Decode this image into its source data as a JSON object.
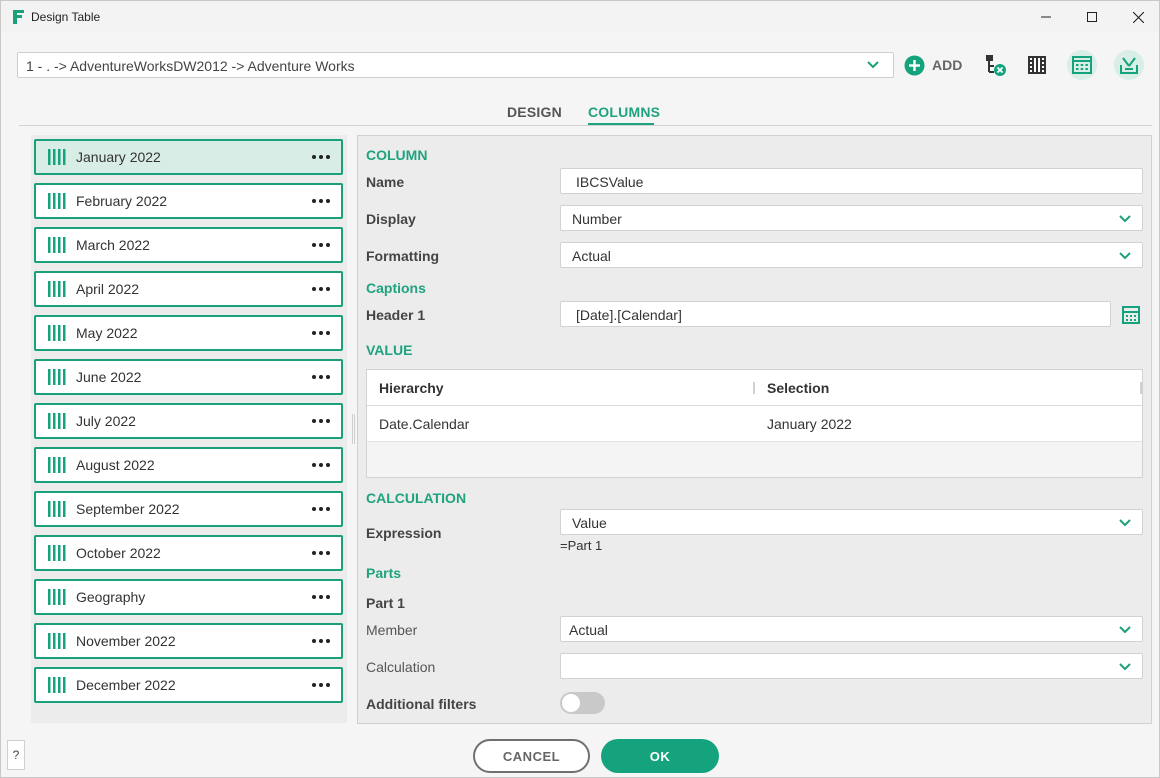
{
  "window": {
    "title": "Design Table"
  },
  "toolbar": {
    "path": "1 - . -> AdventureWorksDW2012 -> Adventure Works",
    "add_label": "ADD",
    "icons": [
      "add-circle-icon",
      "hierarchy-remove-icon",
      "film-columns-icon",
      "calendar-grid-icon",
      "import-icon"
    ]
  },
  "tabs": [
    {
      "label": "DESIGN",
      "active": false
    },
    {
      "label": "COLUMNS",
      "active": true
    }
  ],
  "columns_list": [
    {
      "label": "January 2022",
      "selected": true
    },
    {
      "label": "February 2022"
    },
    {
      "label": "March 2022"
    },
    {
      "label": "April 2022"
    },
    {
      "label": "May 2022"
    },
    {
      "label": "June 2022"
    },
    {
      "label": "July 2022"
    },
    {
      "label": "August 2022"
    },
    {
      "label": "September 2022"
    },
    {
      "label": "October 2022"
    },
    {
      "label": "Geography"
    },
    {
      "label": "November 2022"
    },
    {
      "label": "December 2022"
    }
  ],
  "column": {
    "section": "COLUMN",
    "name_label": "Name",
    "name_value": "IBCSValue",
    "display_label": "Display",
    "display_value": "Number",
    "formatting_label": "Formatting",
    "formatting_value": "Actual"
  },
  "captions": {
    "section": "Captions",
    "header1_label": "Header 1",
    "header1_value": "[Date].[Calendar]"
  },
  "value": {
    "section": "VALUE",
    "columns": [
      "Hierarchy",
      "Selection"
    ],
    "rows": [
      {
        "hierarchy": "Date.Calendar",
        "selection": "January 2022"
      }
    ]
  },
  "calculation": {
    "section": "CALCULATION",
    "expression_label": "Expression",
    "expression_value": "Value",
    "expression_formula": "=Part 1"
  },
  "parts": {
    "section": "Parts",
    "part_title": "Part 1",
    "member_label": "Member",
    "member_value": "Actual",
    "calculation_label": "Calculation",
    "calculation_value": "",
    "filters_label": "Additional filters",
    "filters_enabled": false
  },
  "footer": {
    "help_label": "?",
    "cancel_label": "CANCEL",
    "ok_label": "OK"
  },
  "colors": {
    "accent": "#1fa37f",
    "ok_button": "#14a37d"
  }
}
